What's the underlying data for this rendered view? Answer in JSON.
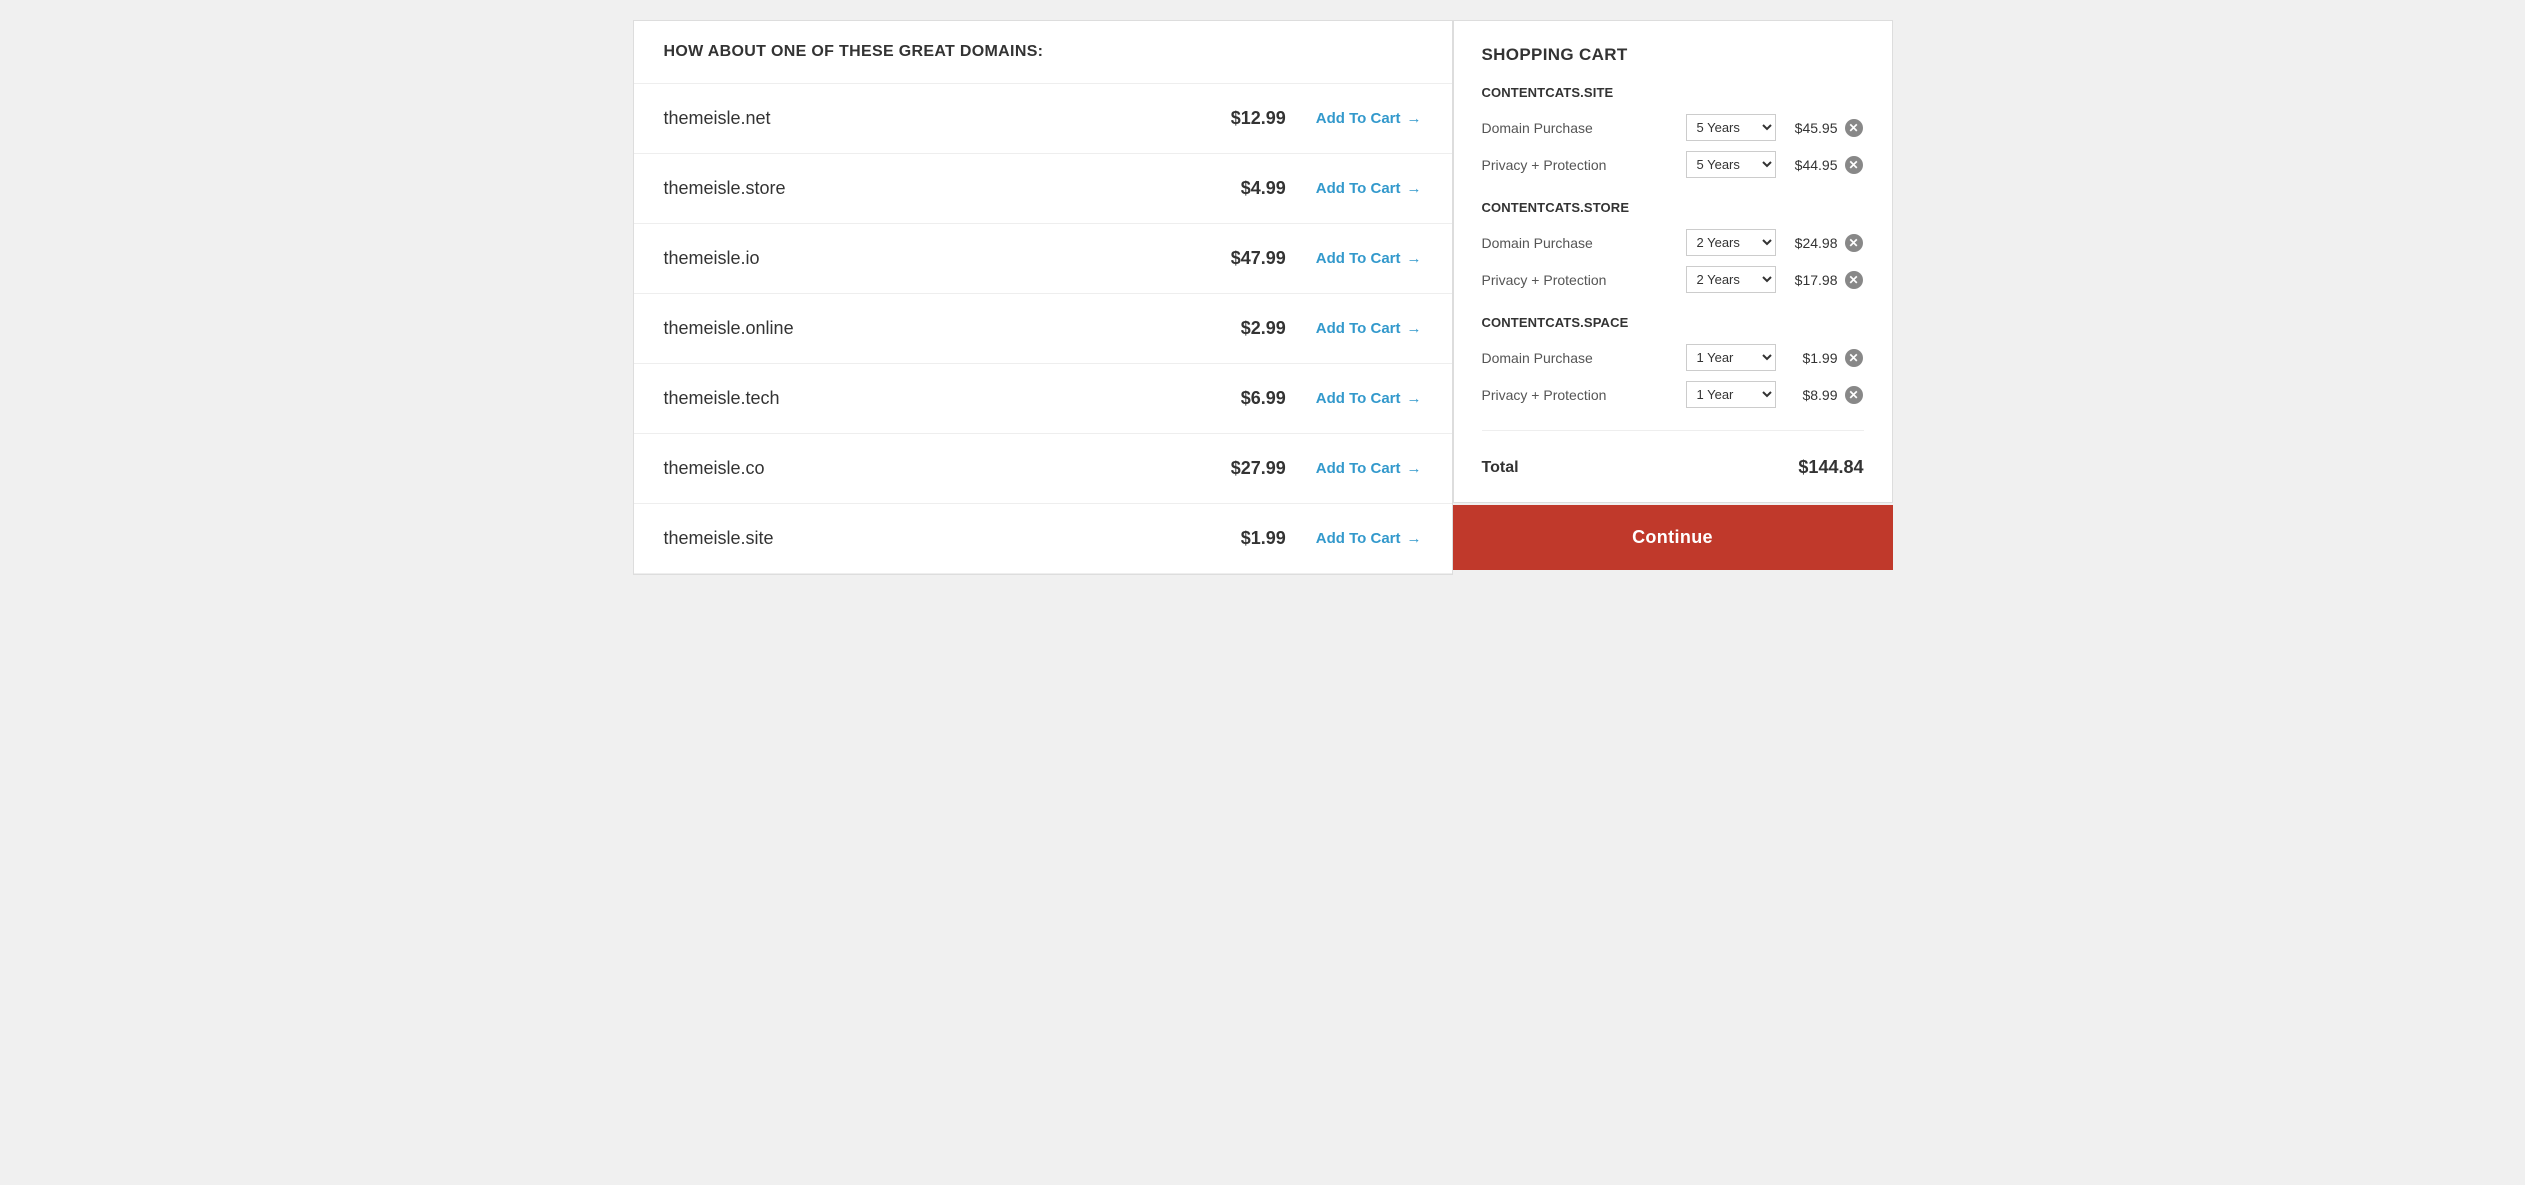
{
  "left_panel": {
    "header": "HOW ABOUT ONE OF THESE GREAT DOMAINS:",
    "domains": [
      {
        "name": "themeisle.net",
        "price": "$12.99",
        "btn_label": "Add To Cart"
      },
      {
        "name": "themeisle.store",
        "price": "$4.99",
        "btn_label": "Add To Cart"
      },
      {
        "name": "themeisle.io",
        "price": "$47.99",
        "btn_label": "Add To Cart"
      },
      {
        "name": "themeisle.online",
        "price": "$2.99",
        "btn_label": "Add To Cart"
      },
      {
        "name": "themeisle.tech",
        "price": "$6.99",
        "btn_label": "Add To Cart"
      },
      {
        "name": "themeisle.co",
        "price": "$27.99",
        "btn_label": "Add To Cart"
      },
      {
        "name": "themeisle.site",
        "price": "$1.99",
        "btn_label": "Add To Cart"
      }
    ]
  },
  "cart": {
    "header": "SHOPPING CART",
    "sections": [
      {
        "domain": "CONTENTCATS.SITE",
        "items": [
          {
            "label": "Domain Purchase",
            "duration": "5 Years",
            "price": "$45.95"
          },
          {
            "label": "Privacy + Protection",
            "duration": "5 Years",
            "price": "$44.95"
          }
        ]
      },
      {
        "domain": "CONTENTCATS.STORE",
        "items": [
          {
            "label": "Domain Purchase",
            "duration": "2 Years",
            "price": "$24.98"
          },
          {
            "label": "Privacy + Protection",
            "duration": "2 Years",
            "price": "$17.98"
          }
        ]
      },
      {
        "domain": "CONTENTCATS.SPACE",
        "items": [
          {
            "label": "Domain Purchase",
            "duration": "1 Year",
            "price": "$1.99"
          },
          {
            "label": "Privacy + Protection",
            "duration": "1 Year",
            "price": "$8.99"
          }
        ]
      }
    ],
    "total_label": "Total",
    "total_amount": "$144.84",
    "continue_label": "Continue"
  }
}
